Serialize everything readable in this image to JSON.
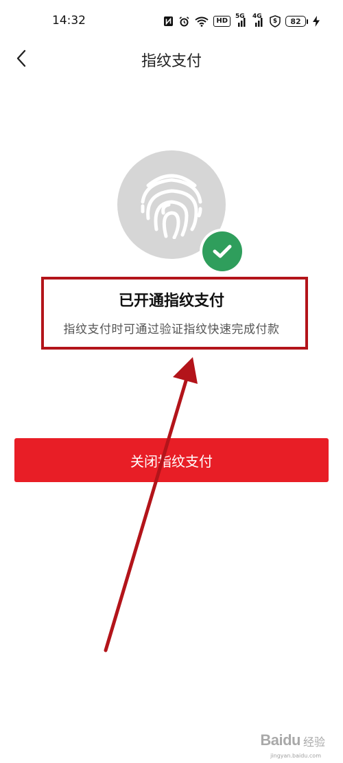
{
  "status_bar": {
    "time": "14:32",
    "icons": [
      "nfc-icon",
      "alarm-icon",
      "wifi-icon",
      "hd-icon",
      "signal-5g-icon",
      "signal-4g-icon",
      "vpn-shield-icon",
      "battery-icon",
      "charging-icon"
    ],
    "hd_label": "HD",
    "net_5g": "5G",
    "net_4g": "4G",
    "shield_symbol": "$",
    "battery_level": "82"
  },
  "nav": {
    "title": "指纹支付",
    "back_icon": "chevron-left-icon"
  },
  "fingerprint": {
    "icon": "fingerprint-icon",
    "badge_icon": "check-icon",
    "badge_color": "#2f9e5c",
    "circle_color": "#d6d6d6"
  },
  "status": {
    "title": "已开通指纹支付",
    "description": "指纹支付时可通过验证指纹快速完成付款"
  },
  "actions": {
    "close_label": "关闭指纹支付",
    "button_color": "#e81e26"
  },
  "annotation": {
    "box_color": "#b3141a",
    "arrow_color": "#b3141a"
  },
  "watermark": {
    "brand": "Baidu",
    "cn": "经验",
    "domain": "jingyan.baidu.com"
  }
}
